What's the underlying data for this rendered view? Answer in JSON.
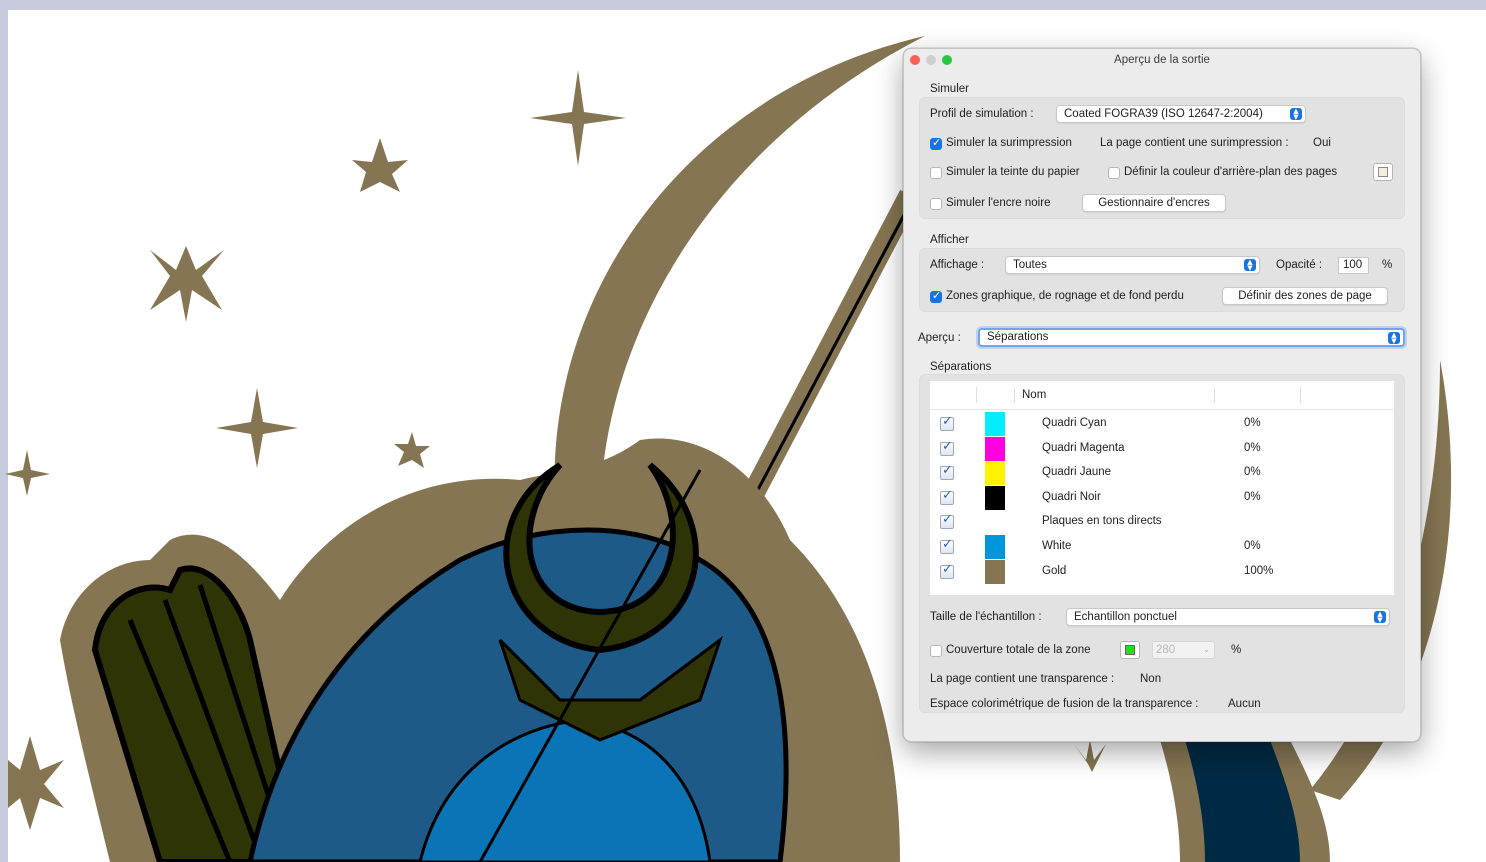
{
  "dialog": {
    "title": "Aperçu de la sortie",
    "simulate": {
      "section_label": "Simuler",
      "profile_label": "Profil de simulation :",
      "profile_value": "Coated FOGRA39 (ISO 12647-2:2004)",
      "overprint_label": "Simuler la surimpression",
      "overprint_checked": true,
      "overprint_info_label": "La page contient une surimpression :",
      "overprint_info_value": "Oui",
      "paper_tint_label": "Simuler la teinte du papier",
      "paper_tint_checked": false,
      "bg_color_label": "Définir la couleur d'arrière-plan des pages",
      "bg_color_checked": false,
      "black_ink_label": "Simuler l'encre noire",
      "black_ink_checked": false,
      "ink_manager_button": "Gestionnaire d'encres"
    },
    "show": {
      "section_label": "Afficher",
      "display_label": "Affichage :",
      "display_value": "Toutes",
      "opacity_label": "Opacité :",
      "opacity_value": "100",
      "opacity_unit": "%",
      "zones_label": "Zones graphique, de rognage et de fond perdu",
      "zones_checked": true,
      "define_zones_button": "Définir des zones de page"
    },
    "preview": {
      "label": "Aperçu :",
      "value": "Séparations"
    },
    "separations": {
      "section_label": "Séparations",
      "column_name": "Nom",
      "rows": [
        {
          "name": "Quadri Cyan",
          "value": "0%",
          "color": "#00eeff"
        },
        {
          "name": "Quadri Magenta",
          "value": "0%",
          "color": "#ff00e0"
        },
        {
          "name": "Quadri Jaune",
          "value": "0%",
          "color": "#fff200"
        },
        {
          "name": "Quadri Noir",
          "value": "0%",
          "color": "#000000"
        },
        {
          "name": "Plaques en tons directs",
          "value": "",
          "color": ""
        },
        {
          "name": "White",
          "value": "0%",
          "color": "#0096dc"
        },
        {
          "name": "Gold",
          "value": "100%",
          "color": "#857552"
        }
      ]
    },
    "sample": {
      "label": "Taille de l'échantillon :",
      "value": "Echantillon ponctuel"
    },
    "coverage": {
      "label": "Couverture totale de la zone",
      "checked": false,
      "swatch_color": "#22dd22",
      "value": "280",
      "unit": "%"
    },
    "transparency": {
      "label": "La page contient une transparence :",
      "value": "Non"
    },
    "blend_space": {
      "label": "Espace colorimétrique de fusion de la transparence :",
      "value": "Aucun"
    }
  },
  "colors": {
    "gold": "#857552",
    "blue_hair": "#1d5a87",
    "blue_face": "#0a74b7",
    "dark_olive": "#2f3407",
    "accent": "#1874e6"
  }
}
